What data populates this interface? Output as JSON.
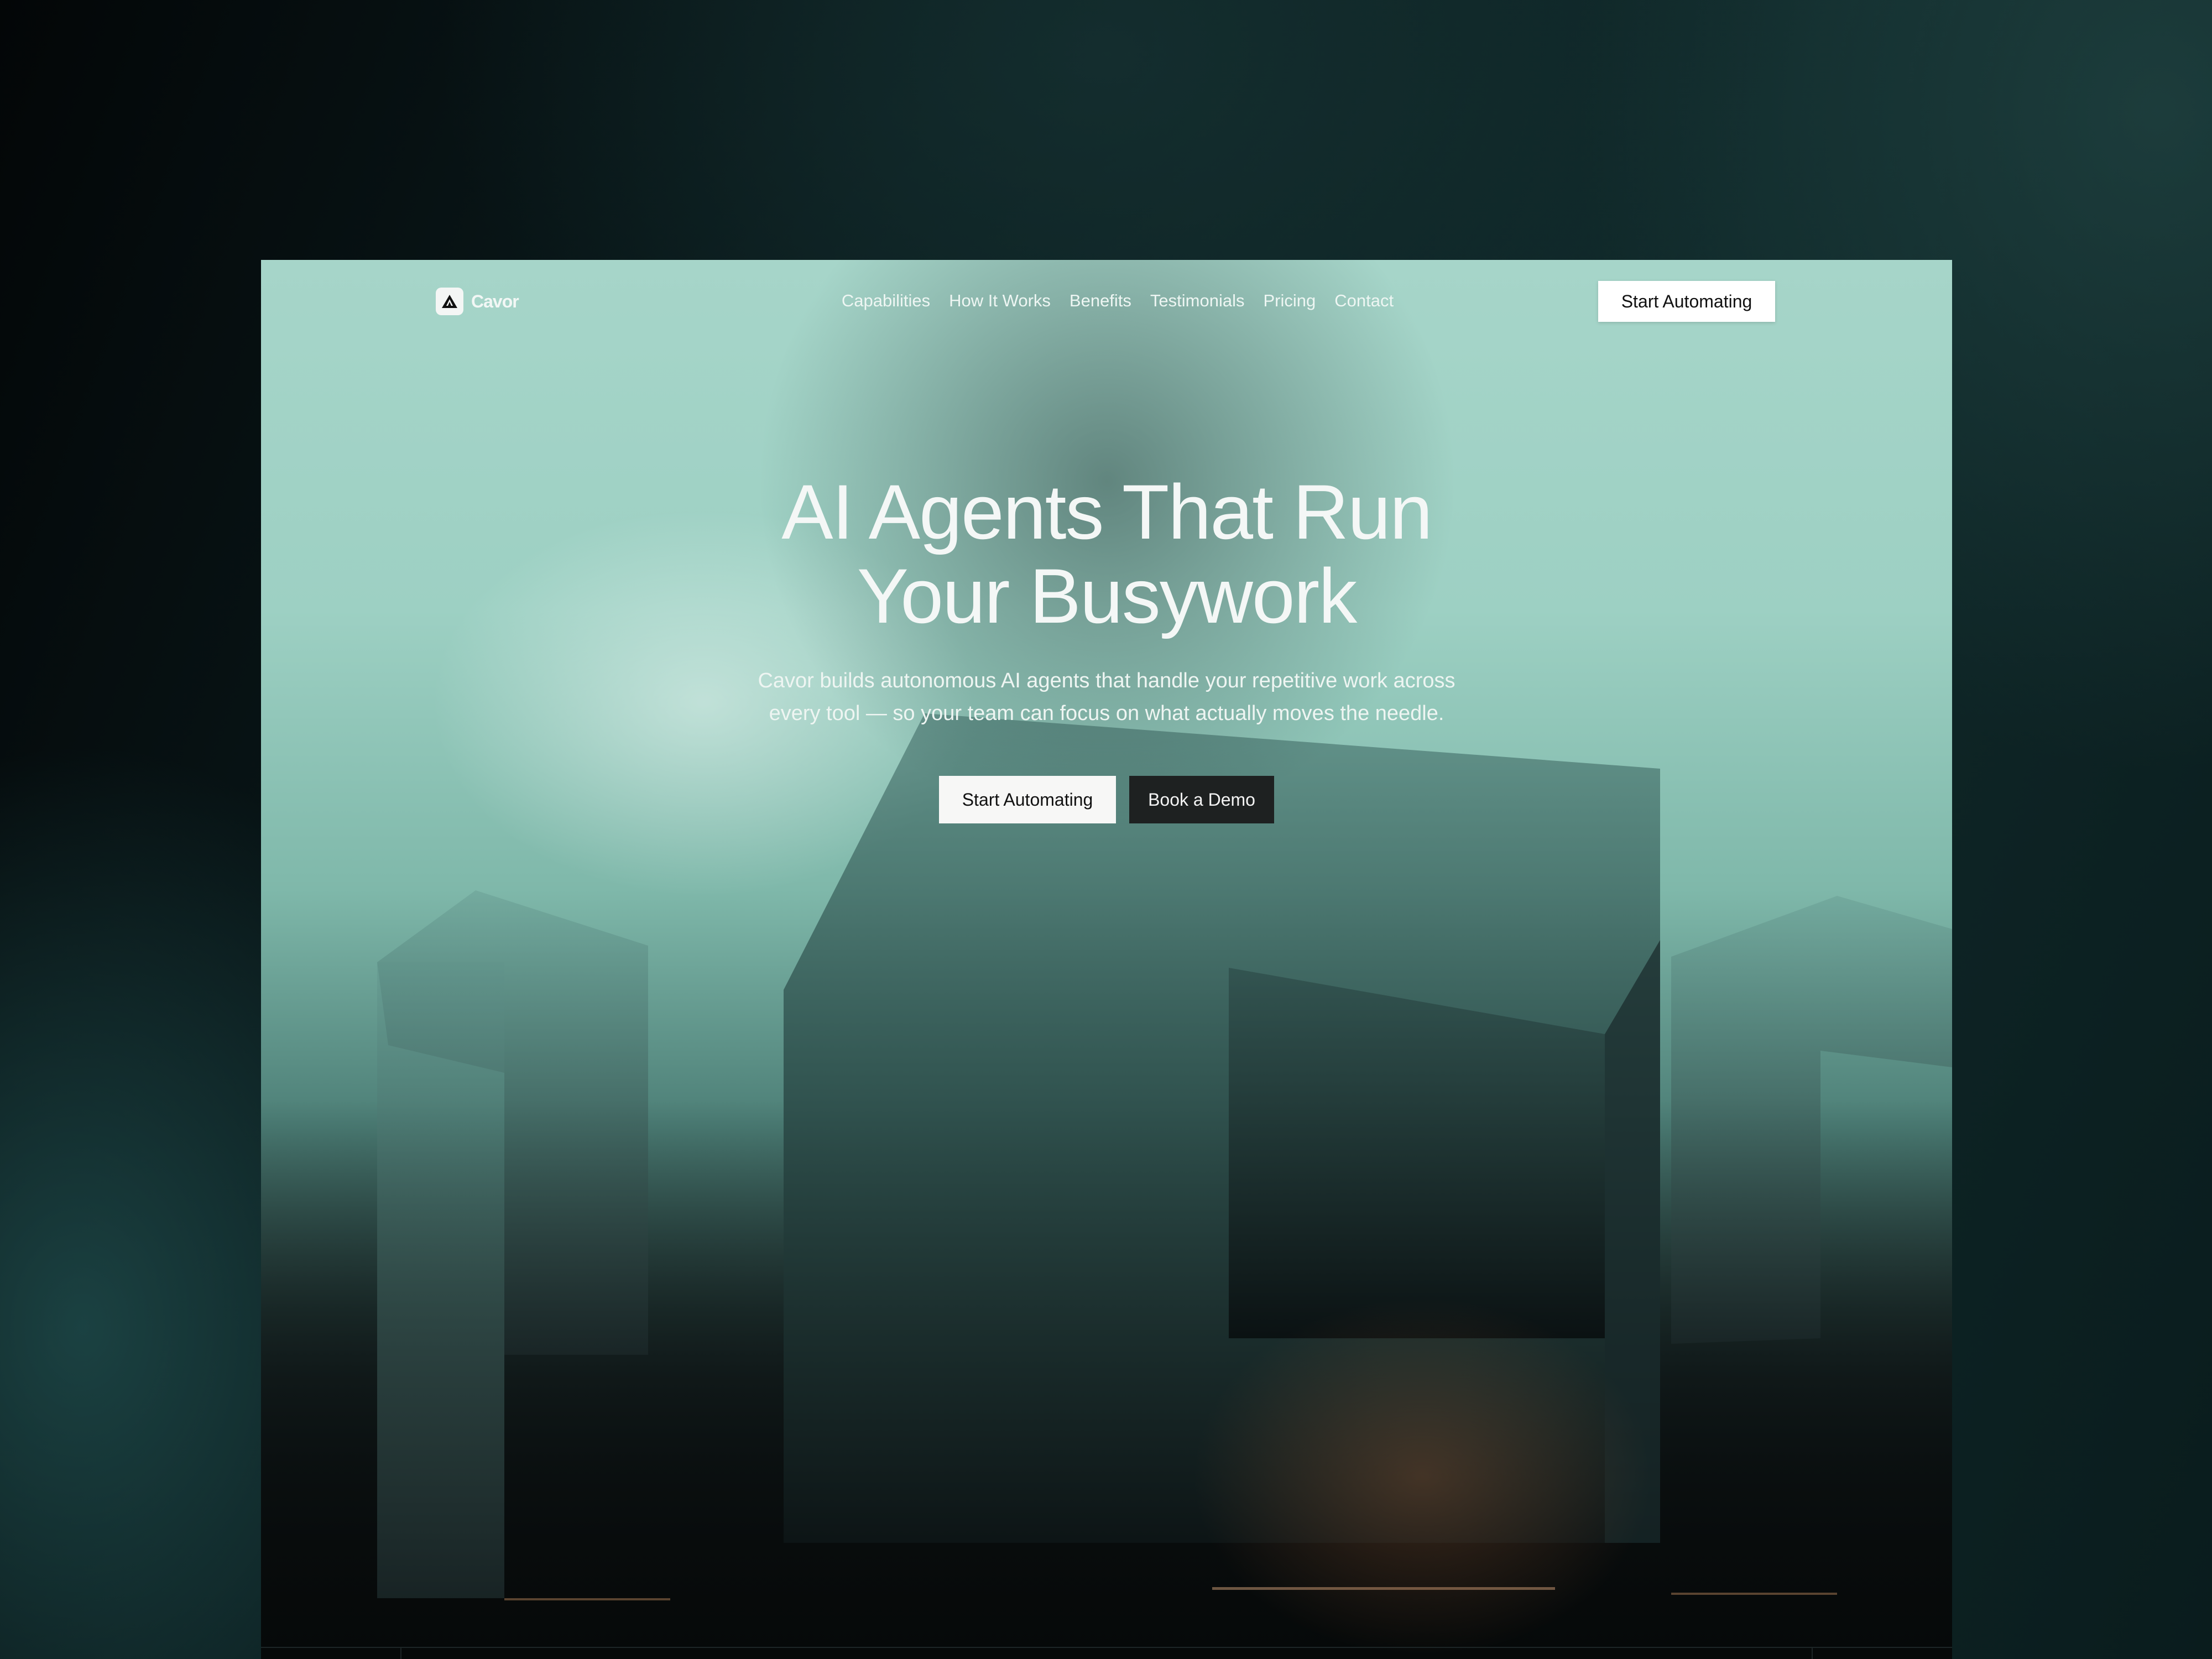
{
  "brand": {
    "name": "Cavor",
    "logo_icon": "triangle-tent-icon"
  },
  "nav": {
    "links": [
      "Capabilities",
      "How It Works",
      "Benefits",
      "Testimonials",
      "Pricing",
      "Contact"
    ],
    "cta_label": "Start Automating"
  },
  "hero": {
    "title_line1": "AI Agents That Run",
    "title_line2": "Your Busywork",
    "subtitle_line1": "Cavor builds autonomous AI agents that handle your repetitive work across",
    "subtitle_line2": "every tool — so your team can focus on what actually moves the needle.",
    "primary_cta": "Start Automating",
    "secondary_cta": "Book a Demo"
  },
  "colors": {
    "accent_light": "#a6d5c9",
    "page_bg": "#0b1d1f",
    "button_light": "#f7f7f6",
    "button_dark": "#1e2121"
  }
}
